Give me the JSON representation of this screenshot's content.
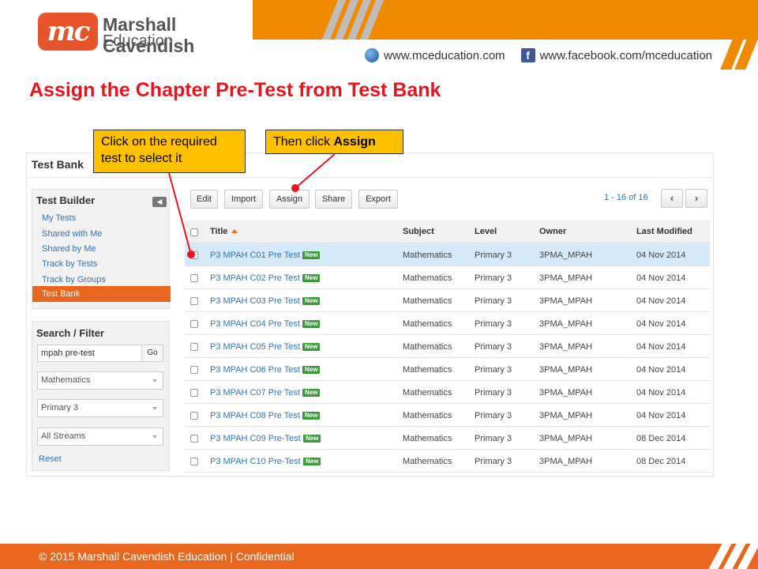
{
  "header": {
    "logo_mark": "mc",
    "logo_line1": "Marshall Cavendish",
    "logo_line2": "Education",
    "website": "www.mceducation.com",
    "facebook": "www.facebook.com/mceducation",
    "brand_color": "#f08a00"
  },
  "slide_title": "Assign the Chapter Pre-Test from Test Bank",
  "callouts": {
    "select_line1": "Click on the required",
    "select_line2": "test to select it",
    "assign_prefix": "Then click ",
    "assign_bold": "Assign"
  },
  "app": {
    "title": "Test Bank",
    "sidebar": {
      "builder_heading": "Test Builder",
      "collapse_glyph": "◀",
      "items": [
        "My Tests",
        "Shared with Me",
        "Shared by Me",
        "Track by Tests",
        "Track by Groups",
        "Test Bank"
      ],
      "active_item": "Test Bank",
      "filter_heading": "Search / Filter",
      "search_value": "mpah pre-test",
      "go_label": "Go",
      "subject_select": "Mathematics",
      "level_select": "Primary 3",
      "stream_select": "All Streams",
      "reset_label": "Reset"
    },
    "toolbar": {
      "edit": "Edit",
      "import": "Import",
      "assign": "Assign",
      "share": "Share",
      "export": "Export",
      "pager_text": "1 - 16 of 16",
      "prev_glyph": "‹",
      "next_glyph": "›"
    },
    "table": {
      "columns": [
        "Title",
        "Subject",
        "Level",
        "Owner",
        "Last Modified"
      ],
      "badge_label": "New",
      "rows": [
        {
          "title": "P3 MPAH C01 Pre Test",
          "subject": "Mathematics",
          "level": "Primary 3",
          "owner": "3PMA_MPAH",
          "modified": "04 Nov 2014",
          "selected": true
        },
        {
          "title": "P3 MPAH C02 Pre Test",
          "subject": "Mathematics",
          "level": "Primary 3",
          "owner": "3PMA_MPAH",
          "modified": "04 Nov 2014",
          "selected": false
        },
        {
          "title": "P3 MPAH C03 Pre Test",
          "subject": "Mathematics",
          "level": "Primary 3",
          "owner": "3PMA_MPAH",
          "modified": "04 Nov 2014",
          "selected": false
        },
        {
          "title": "P3 MPAH C04 Pre Test",
          "subject": "Mathematics",
          "level": "Primary 3",
          "owner": "3PMA_MPAH",
          "modified": "04 Nov 2014",
          "selected": false
        },
        {
          "title": "P3 MPAH C05 Pre Test",
          "subject": "Mathematics",
          "level": "Primary 3",
          "owner": "3PMA_MPAH",
          "modified": "04 Nov 2014",
          "selected": false
        },
        {
          "title": "P3 MPAH C06 Pre Test",
          "subject": "Mathematics",
          "level": "Primary 3",
          "owner": "3PMA_MPAH",
          "modified": "04 Nov 2014",
          "selected": false
        },
        {
          "title": "P3 MPAH C07 Pre Test",
          "subject": "Mathematics",
          "level": "Primary 3",
          "owner": "3PMA_MPAH",
          "modified": "04 Nov 2014",
          "selected": false
        },
        {
          "title": "P3 MPAH C08 Pre Test",
          "subject": "Mathematics",
          "level": "Primary 3",
          "owner": "3PMA_MPAH",
          "modified": "04 Nov 2014",
          "selected": false
        },
        {
          "title": "P3 MPAH C09 Pre-Test",
          "subject": "Mathematics",
          "level": "Primary 3",
          "owner": "3PMA_MPAH",
          "modified": "08 Dec 2014",
          "selected": false
        },
        {
          "title": "P3 MPAH C10 Pre-Test",
          "subject": "Mathematics",
          "level": "Primary 3",
          "owner": "3PMA_MPAH",
          "modified": "08 Dec 2014",
          "selected": false
        }
      ]
    }
  },
  "footer": {
    "text": "© 2015 Marshall Cavendish Education | Confidential",
    "color": "#e8661e"
  }
}
